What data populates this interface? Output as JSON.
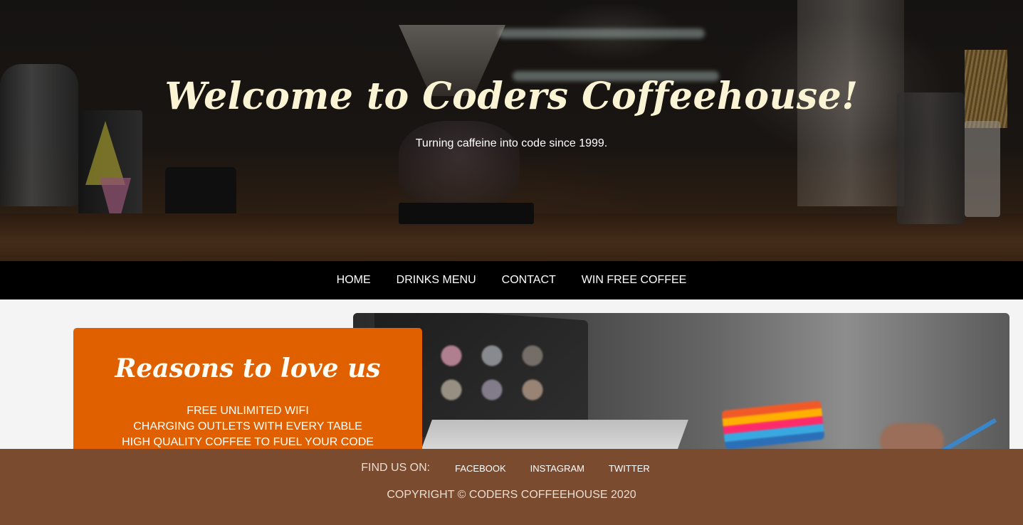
{
  "hero": {
    "title": "Welcome to Coders Coffeehouse!",
    "subtitle": "Turning caffeine into code since 1999."
  },
  "nav": {
    "items": [
      {
        "label": "HOME"
      },
      {
        "label": "DRINKS MENU"
      },
      {
        "label": "CONTACT"
      },
      {
        "label": "WIN FREE COFFEE"
      }
    ]
  },
  "reasons": {
    "heading": "Reasons to love us",
    "items": [
      "FREE UNLIMITED WIFI",
      "CHARGING OUTLETS WITH EVERY TABLE",
      "HIGH QUALITY COFFEE TO FUEL YOUR CODE"
    ]
  },
  "footer": {
    "find_us_label": "FIND US ON:",
    "social": [
      {
        "label": "FACEBOOK"
      },
      {
        "label": "INSTAGRAM"
      },
      {
        "label": "TWITTER"
      }
    ],
    "copyright": "COPYRIGHT © CODERS COFFEEHOUSE 2020"
  },
  "colors": {
    "nav_bg": "#000000",
    "accent_orange": "#e06000",
    "footer_brown": "#7b4b2f",
    "title_cream": "#fbf4d4"
  }
}
